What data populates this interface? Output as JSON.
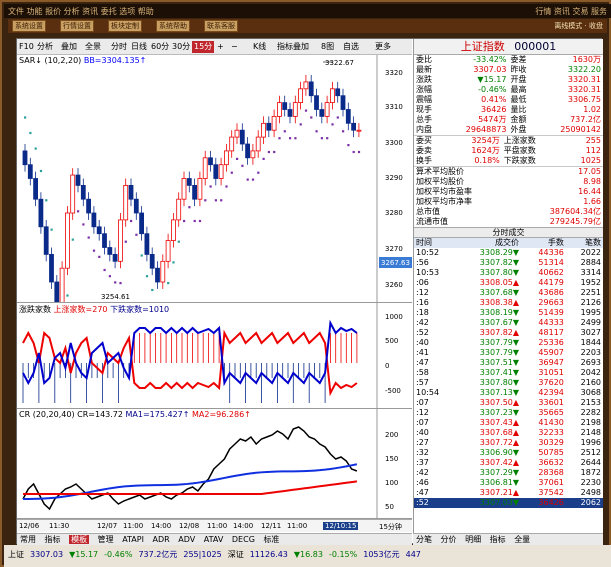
{
  "topbar": {
    "left": "文件  功能  报价  分析  资讯  委托  选项  帮助",
    "right": "行情 资讯 交易 服务"
  },
  "menu": {
    "buttons": [
      "系统设置",
      "行情设置",
      "板块定制",
      "系统帮助",
      "联系客服"
    ],
    "right": "离线模式 · 收盘"
  },
  "toolbar": {
    "items": [
      "F10",
      "分析",
      "叠加",
      "全景",
      "分时",
      "日线",
      "60分",
      "30分",
      "15分",
      "+",
      "−",
      "K线",
      "指标叠加",
      "8图",
      "自选",
      "更多"
    ],
    "active": "15分"
  },
  "main_chart": {
    "label": "SAR↓ (10,2,20)",
    "value": "BB=3304.135↑",
    "high_label": "3322.67",
    "low_label": "3254.61",
    "right_value": "3267.63",
    "yticks": [
      "3320",
      "3310",
      "3300",
      "3290",
      "3280",
      "3270",
      "3260"
    ]
  },
  "panel2": {
    "label": "涨跌家数",
    "l1": "上涨家数=270",
    "l2": "下跌家数=1010",
    "yticks": [
      "1000",
      "500",
      "0",
      "-500"
    ]
  },
  "panel3": {
    "label": "CR",
    "params": "(20,20,40)",
    "cr": "CR=143.72",
    "ma1": "MA1=175.427↑",
    "ma2": "MA2=96.286↑",
    "yticks": [
      "200",
      "150",
      "100",
      "50"
    ]
  },
  "xaxis": [
    "12/06",
    "11:30",
    "12/07",
    "11:00",
    "14:00",
    "12/08",
    "11:00",
    "14:00",
    "12/11",
    "11:00",
    "12/10:15"
  ],
  "xaxis_right": "15分钟",
  "quote": {
    "title": "上证指数",
    "code": "000001",
    "rows": [
      [
        "委比",
        "-33.42%",
        "委差",
        "1630万"
      ],
      [
        "最新",
        "3307.03",
        "昨收",
        "3322.20"
      ],
      [
        "涨跌",
        "▼15.17",
        "开盘",
        "3320.31"
      ],
      [
        "涨幅",
        "-0.46%",
        "最高",
        "3320.31"
      ],
      [
        "震幅",
        "0.41%",
        "最低",
        "3306.75"
      ],
      [
        "现手",
        "36426",
        "量比",
        "1.02"
      ],
      [
        "总手",
        "5474万",
        "金额",
        "737.2亿"
      ],
      [
        "内盘",
        "29648873",
        "外盘",
        "25090142"
      ]
    ],
    "rows2": [
      [
        "委买",
        "3254万",
        "上涨家数",
        "255"
      ],
      [
        "委卖",
        "1624万",
        "平盘家数",
        "112"
      ],
      [
        "换手",
        "0.18%",
        "下跌家数",
        "1025"
      ]
    ],
    "rows3": [
      [
        "算术平均股价",
        "17.05"
      ],
      [
        "加权平均股价",
        "8.98"
      ],
      [
        "加权平均市盈率",
        "16.44"
      ],
      [
        "加权平均市净率",
        "1.66"
      ],
      [
        "总市值",
        "387604.34亿"
      ],
      [
        "流通市值",
        "279245.79亿"
      ]
    ]
  },
  "ticks": {
    "title": "分时成交",
    "headers": [
      "时间",
      "成交价",
      "手数",
      "笔数"
    ],
    "rows": [
      [
        "10:52",
        "3308.29▼",
        "44336",
        "2022"
      ],
      [
        ":56",
        "3307.82▼",
        "51314",
        "2884"
      ],
      [
        "10:53",
        "3307.80▼",
        "40662",
        "3314"
      ],
      [
        ":06",
        "3308.05▲",
        "44179",
        "1952"
      ],
      [
        ":12",
        "3307.68▼",
        "43686",
        "2251"
      ],
      [
        ":16",
        "3308.38▲",
        "29663",
        "2126"
      ],
      [
        ":18",
        "3308.19▼",
        "51439",
        "1995"
      ],
      [
        ":42",
        "3307.67▼",
        "44333",
        "2499"
      ],
      [
        ":52",
        "3307.82▲",
        "48117",
        "3027"
      ],
      [
        ":40",
        "3307.79▼",
        "25336",
        "1844"
      ],
      [
        ":41",
        "3307.79▼",
        "45907",
        "2203"
      ],
      [
        ":47",
        "3307.51▼",
        "36947",
        "2693"
      ],
      [
        ":58",
        "3307.41▼",
        "31051",
        "2042"
      ],
      [
        ":57",
        "3307.80▼",
        "37620",
        "2160"
      ],
      [
        "10:54",
        "3307.13▼",
        "42394",
        "3068"
      ],
      [
        ":07",
        "3307.50▲",
        "33601",
        "2153"
      ],
      [
        ":12",
        "3307.23▼",
        "35665",
        "2282"
      ],
      [
        ":07",
        "3307.43▲",
        "41430",
        "2198"
      ],
      [
        ":40",
        "3307.68▲",
        "32233",
        "2148"
      ],
      [
        ":27",
        "3307.72▲",
        "30329",
        "1996"
      ],
      [
        ":32",
        "3306.90▼",
        "50785",
        "2512"
      ],
      [
        ":37",
        "3307.42▲",
        "36632",
        "2644"
      ],
      [
        ":42",
        "3307.29▼",
        "28368",
        "1872"
      ],
      [
        ":46",
        "3306.81▼",
        "37061",
        "2230"
      ],
      [
        ":47",
        "3307.21▲",
        "37542",
        "2498"
      ],
      [
        ":52",
        "3307.03▼",
        "36426",
        "2062"
      ]
    ]
  },
  "bottom_tabs": [
    "常用",
    "指标",
    "模板",
    "管理",
    "ATAPI",
    "ADR",
    "ADV",
    "ATAV",
    "DECG",
    "标准",
    "深度分析",
    "星耀经典",
    "指标分析"
  ],
  "right_tabs": [
    "分笔",
    "分价",
    "明细",
    "指标",
    "全量",
    "资金",
    "帐户"
  ],
  "status": [
    "上证",
    "3307.03",
    "▼15.17",
    "-0.46%",
    "737.2亿元",
    "255|1025",
    "深证",
    "11126.43",
    "▼16.83",
    "-0.15%",
    "1053亿元",
    "447"
  ]
}
